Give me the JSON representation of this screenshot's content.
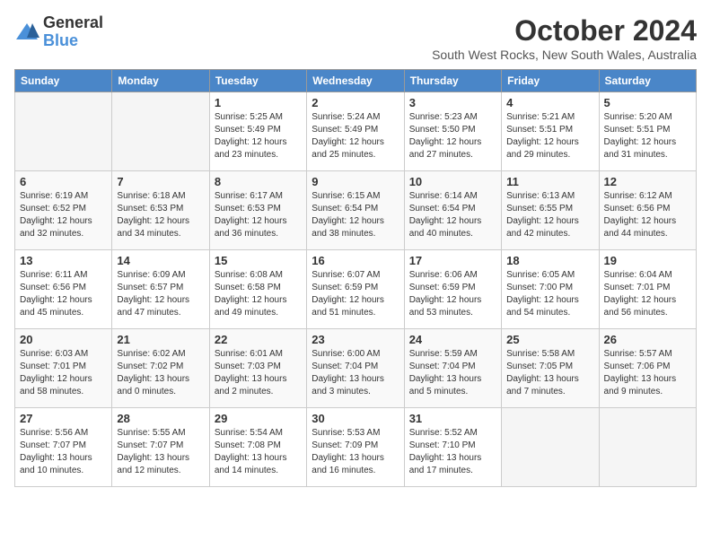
{
  "logo": {
    "general": "General",
    "blue": "Blue"
  },
  "title": "October 2024",
  "subtitle": "South West Rocks, New South Wales, Australia",
  "headers": [
    "Sunday",
    "Monday",
    "Tuesday",
    "Wednesday",
    "Thursday",
    "Friday",
    "Saturday"
  ],
  "weeks": [
    [
      {
        "day": "",
        "info": ""
      },
      {
        "day": "",
        "info": ""
      },
      {
        "day": "1",
        "info": "Sunrise: 5:25 AM\nSunset: 5:49 PM\nDaylight: 12 hours and 23 minutes."
      },
      {
        "day": "2",
        "info": "Sunrise: 5:24 AM\nSunset: 5:49 PM\nDaylight: 12 hours and 25 minutes."
      },
      {
        "day": "3",
        "info": "Sunrise: 5:23 AM\nSunset: 5:50 PM\nDaylight: 12 hours and 27 minutes."
      },
      {
        "day": "4",
        "info": "Sunrise: 5:21 AM\nSunset: 5:51 PM\nDaylight: 12 hours and 29 minutes."
      },
      {
        "day": "5",
        "info": "Sunrise: 5:20 AM\nSunset: 5:51 PM\nDaylight: 12 hours and 31 minutes."
      }
    ],
    [
      {
        "day": "6",
        "info": "Sunrise: 6:19 AM\nSunset: 6:52 PM\nDaylight: 12 hours and 32 minutes."
      },
      {
        "day": "7",
        "info": "Sunrise: 6:18 AM\nSunset: 6:53 PM\nDaylight: 12 hours and 34 minutes."
      },
      {
        "day": "8",
        "info": "Sunrise: 6:17 AM\nSunset: 6:53 PM\nDaylight: 12 hours and 36 minutes."
      },
      {
        "day": "9",
        "info": "Sunrise: 6:15 AM\nSunset: 6:54 PM\nDaylight: 12 hours and 38 minutes."
      },
      {
        "day": "10",
        "info": "Sunrise: 6:14 AM\nSunset: 6:54 PM\nDaylight: 12 hours and 40 minutes."
      },
      {
        "day": "11",
        "info": "Sunrise: 6:13 AM\nSunset: 6:55 PM\nDaylight: 12 hours and 42 minutes."
      },
      {
        "day": "12",
        "info": "Sunrise: 6:12 AM\nSunset: 6:56 PM\nDaylight: 12 hours and 44 minutes."
      }
    ],
    [
      {
        "day": "13",
        "info": "Sunrise: 6:11 AM\nSunset: 6:56 PM\nDaylight: 12 hours and 45 minutes."
      },
      {
        "day": "14",
        "info": "Sunrise: 6:09 AM\nSunset: 6:57 PM\nDaylight: 12 hours and 47 minutes."
      },
      {
        "day": "15",
        "info": "Sunrise: 6:08 AM\nSunset: 6:58 PM\nDaylight: 12 hours and 49 minutes."
      },
      {
        "day": "16",
        "info": "Sunrise: 6:07 AM\nSunset: 6:59 PM\nDaylight: 12 hours and 51 minutes."
      },
      {
        "day": "17",
        "info": "Sunrise: 6:06 AM\nSunset: 6:59 PM\nDaylight: 12 hours and 53 minutes."
      },
      {
        "day": "18",
        "info": "Sunrise: 6:05 AM\nSunset: 7:00 PM\nDaylight: 12 hours and 54 minutes."
      },
      {
        "day": "19",
        "info": "Sunrise: 6:04 AM\nSunset: 7:01 PM\nDaylight: 12 hours and 56 minutes."
      }
    ],
    [
      {
        "day": "20",
        "info": "Sunrise: 6:03 AM\nSunset: 7:01 PM\nDaylight: 12 hours and 58 minutes."
      },
      {
        "day": "21",
        "info": "Sunrise: 6:02 AM\nSunset: 7:02 PM\nDaylight: 13 hours and 0 minutes."
      },
      {
        "day": "22",
        "info": "Sunrise: 6:01 AM\nSunset: 7:03 PM\nDaylight: 13 hours and 2 minutes."
      },
      {
        "day": "23",
        "info": "Sunrise: 6:00 AM\nSunset: 7:04 PM\nDaylight: 13 hours and 3 minutes."
      },
      {
        "day": "24",
        "info": "Sunrise: 5:59 AM\nSunset: 7:04 PM\nDaylight: 13 hours and 5 minutes."
      },
      {
        "day": "25",
        "info": "Sunrise: 5:58 AM\nSunset: 7:05 PM\nDaylight: 13 hours and 7 minutes."
      },
      {
        "day": "26",
        "info": "Sunrise: 5:57 AM\nSunset: 7:06 PM\nDaylight: 13 hours and 9 minutes."
      }
    ],
    [
      {
        "day": "27",
        "info": "Sunrise: 5:56 AM\nSunset: 7:07 PM\nDaylight: 13 hours and 10 minutes."
      },
      {
        "day": "28",
        "info": "Sunrise: 5:55 AM\nSunset: 7:07 PM\nDaylight: 13 hours and 12 minutes."
      },
      {
        "day": "29",
        "info": "Sunrise: 5:54 AM\nSunset: 7:08 PM\nDaylight: 13 hours and 14 minutes."
      },
      {
        "day": "30",
        "info": "Sunrise: 5:53 AM\nSunset: 7:09 PM\nDaylight: 13 hours and 16 minutes."
      },
      {
        "day": "31",
        "info": "Sunrise: 5:52 AM\nSunset: 7:10 PM\nDaylight: 13 hours and 17 minutes."
      },
      {
        "day": "",
        "info": ""
      },
      {
        "day": "",
        "info": ""
      }
    ]
  ]
}
